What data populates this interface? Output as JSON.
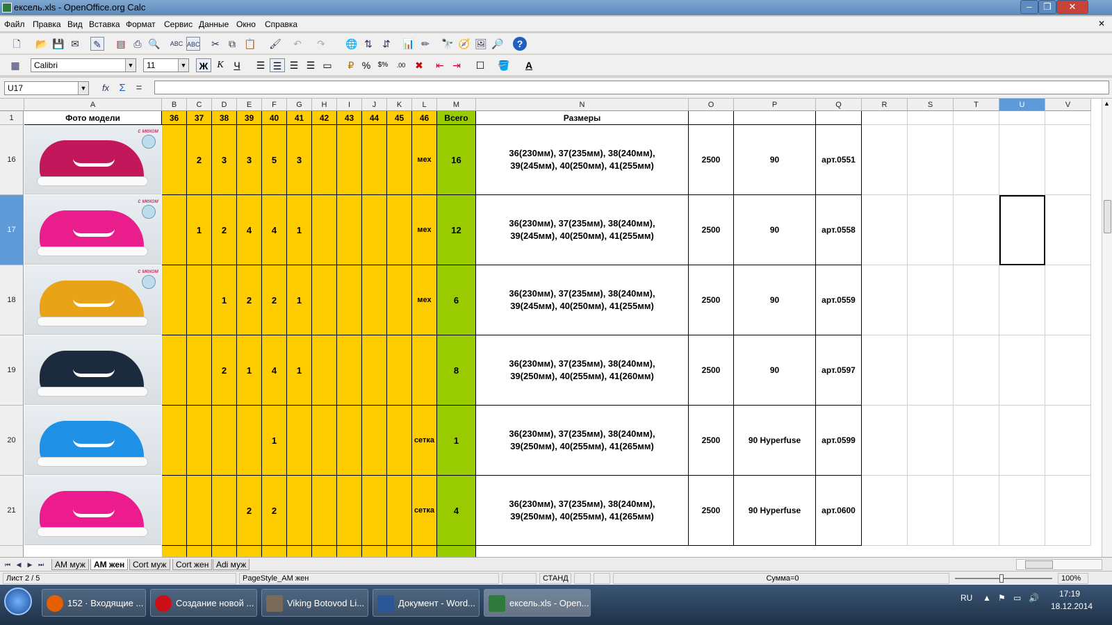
{
  "window": {
    "title": "ексель.xls - OpenOffice.org Calc"
  },
  "menu": [
    "Файл",
    "Правка",
    "Вид",
    "Вставка",
    "Формат",
    "Сервис",
    "Данные",
    "Окно",
    "Справка"
  ],
  "format": {
    "font": "Calibri",
    "size": "11",
    "bold": "Ж",
    "italic": "К",
    "underline": "Ч"
  },
  "formula": {
    "cell_ref": "U17",
    "fx": "fx",
    "sum": "Σ",
    "eq": "=",
    "value": ""
  },
  "columns": [
    "A",
    "B",
    "C",
    "D",
    "E",
    "F",
    "G",
    "H",
    "I",
    "J",
    "K",
    "L",
    "M",
    "N",
    "O",
    "P",
    "Q",
    "R",
    "S",
    "T",
    "U",
    "V"
  ],
  "header_row": {
    "row": "1",
    "photo": "Фото модели",
    "sizes": [
      "36",
      "37",
      "38",
      "39",
      "40",
      "41",
      "42",
      "43",
      "44",
      "45",
      "46"
    ],
    "total": "Всего",
    "sizes_label": "Размеры"
  },
  "rows": [
    {
      "row": "16",
      "counts": [
        "",
        "2",
        "3",
        "3",
        "5",
        "3",
        "",
        "",
        "",
        "",
        ""
      ],
      "type": "мех",
      "total": "16",
      "sizes_line1": "36(230мм), 37(235мм), 38(240мм),",
      "sizes_line2": "39(245мм), 40(250мм), 41(255мм)",
      "price": "2500",
      "model": "90",
      "art": "арт.0551",
      "shoe_color": "#c2185b",
      "mex": "с мехом"
    },
    {
      "row": "17",
      "counts": [
        "",
        "1",
        "2",
        "4",
        "4",
        "1",
        "",
        "",
        "",
        "",
        ""
      ],
      "type": "мех",
      "total": "12",
      "sizes_line1": "36(230мм), 37(235мм), 38(240мм),",
      "sizes_line2": "39(245мм), 40(250мм), 41(255мм)",
      "price": "2500",
      "model": "90",
      "art": "арт.0558",
      "shoe_color": "#e91e8c",
      "mex": "с мехом"
    },
    {
      "row": "18",
      "counts": [
        "",
        "",
        "1",
        "2",
        "2",
        "1",
        "",
        "",
        "",
        "",
        ""
      ],
      "type": "мех",
      "total": "6",
      "sizes_line1": "36(230мм), 37(235мм), 38(240мм),",
      "sizes_line2": "39(245мм), 40(250мм), 41(255мм)",
      "price": "2500",
      "model": "90",
      "art": "арт.0559",
      "shoe_color": "#e8a317",
      "mex": "с мехом"
    },
    {
      "row": "19",
      "counts": [
        "",
        "",
        "2",
        "1",
        "4",
        "1",
        "",
        "",
        "",
        "",
        ""
      ],
      "type": "",
      "total": "8",
      "sizes_line1": "36(230мм), 37(235мм), 38(240мм),",
      "sizes_line2": "39(250мм), 40(255мм), 41(260мм)",
      "price": "2500",
      "model": "90",
      "art": "арт.0597",
      "shoe_color": "#1c2a3e",
      "mex": ""
    },
    {
      "row": "20",
      "counts": [
        "",
        "",
        "",
        "",
        "1",
        "",
        "",
        "",
        "",
        "",
        ""
      ],
      "type": "сетка",
      "total": "1",
      "sizes_line1": "36(230мм), 37(235мм), 38(240мм),",
      "sizes_line2": "39(250мм), 40(255мм), 41(265мм)",
      "price": "2500",
      "model": "90 Hyperfuse",
      "art": "арт.0599",
      "shoe_color": "#1e90e6",
      "mex": ""
    },
    {
      "row": "21",
      "counts": [
        "",
        "",
        "",
        "2",
        "2",
        "",
        "",
        "",
        "",
        "",
        ""
      ],
      "type": "сетка",
      "total": "4",
      "sizes_line1": "36(230мм), 37(235мм), 38(240мм),",
      "sizes_line2": "39(250мм), 40(255мм), 41(265мм)",
      "price": "2500",
      "model": "90 Hyperfuse",
      "art": "арт.0600",
      "shoe_color": "#ec1c8f",
      "mex": ""
    }
  ],
  "sheets": [
    "AM муж",
    "AM жен",
    "Cort муж",
    "Cort жен",
    "Adi муж"
  ],
  "active_sheet": "AM жен",
  "status": {
    "sheet": "Лист 2 / 5",
    "page_style": "PageStyle_AM жен",
    "mode": "СТАНД",
    "sum": "Сумма=0",
    "zoom": "100%"
  },
  "taskbar": {
    "tasks": [
      {
        "label": "152 · Входящие ...",
        "color": "#e66000"
      },
      {
        "label": "Создание новой ...",
        "color": "#cc0f16"
      },
      {
        "label": "Viking Botovod Li...",
        "color": "#7a6a5a"
      },
      {
        "label": "Документ - Word...",
        "color": "#2b5797"
      },
      {
        "label": "ексель.xls - Open...",
        "color": "#2f7a3c"
      }
    ],
    "lang": "RU",
    "time": "17:19",
    "date": "18.12.2014"
  }
}
